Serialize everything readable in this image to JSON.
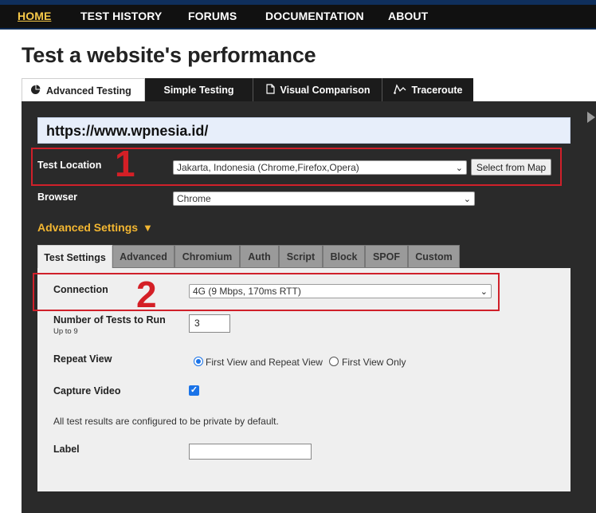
{
  "nav": {
    "home": "HOME",
    "test_history": "TEST HISTORY",
    "forums": "FORUMS",
    "documentation": "DOCUMENTATION",
    "about": "ABOUT"
  },
  "page_title": "Test a website's performance",
  "tabs": {
    "advanced": "Advanced Testing",
    "simple": "Simple Testing",
    "visual": "Visual Comparison",
    "traceroute": "Traceroute"
  },
  "url_value": "https://www.wpnesia.id/",
  "test_location": {
    "label": "Test Location",
    "value": "Jakarta, Indonesia (Chrome,Firefox,Opera)",
    "button": "Select from Map"
  },
  "browser": {
    "label": "Browser",
    "value": "Chrome"
  },
  "advanced_settings_label": "Advanced Settings",
  "annotations": {
    "one": "1",
    "two": "2"
  },
  "subtabs": {
    "test_settings": "Test Settings",
    "advanced": "Advanced",
    "chromium": "Chromium",
    "auth": "Auth",
    "script": "Script",
    "block": "Block",
    "spof": "SPOF",
    "custom": "Custom"
  },
  "connection": {
    "label": "Connection",
    "value": "4G (9 Mbps, 170ms RTT)"
  },
  "num_tests": {
    "label": "Number of Tests to Run",
    "hint": "Up to 9",
    "value": "3"
  },
  "repeat_view": {
    "label": "Repeat View",
    "option_first_repeat": "First View and Repeat View",
    "option_first_only": "First View Only",
    "selected": "First View and Repeat View"
  },
  "capture_video": {
    "label": "Capture Video",
    "checked": true
  },
  "private_note": "All test results are configured to be private by default.",
  "label_field": {
    "label": "Label",
    "value": ""
  },
  "colors": {
    "nav_bg": "#111111",
    "nav_active": "#f7c948",
    "panel_bg": "#2a2a2a",
    "accent_orange": "#f2b632",
    "annotation_red": "#d41f26",
    "control_blue": "#1a73e8"
  }
}
